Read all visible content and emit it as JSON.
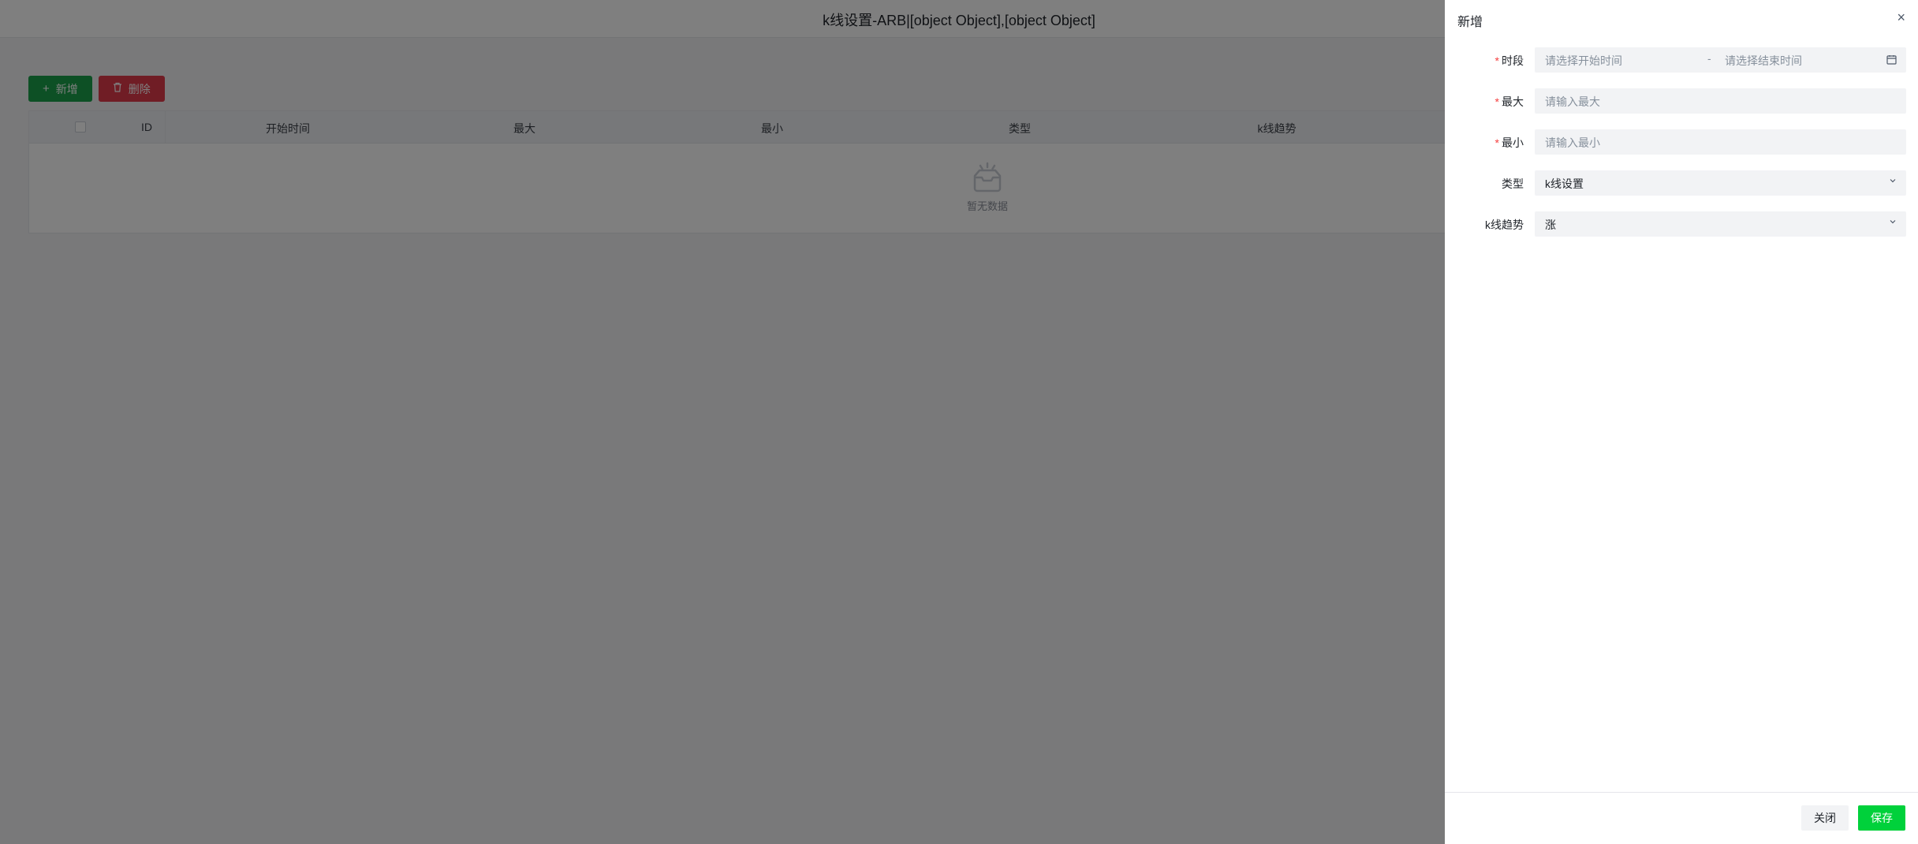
{
  "page": {
    "title": "k线设置-ARB|[object Object],[object Object]",
    "toolbar": {
      "add_label": "新增",
      "delete_label": "删除"
    },
    "table": {
      "columns": [
        "ID",
        "开始时间",
        "最大",
        "最小",
        "类型",
        "k线趋势"
      ],
      "empty_text": "暂无数据"
    }
  },
  "drawer": {
    "title": "新增",
    "close_glyph": "×",
    "fields": {
      "period": {
        "label": "时段",
        "required": true,
        "start_placeholder": "请选择开始时间",
        "separator": "-",
        "end_placeholder": "请选择结束时间"
      },
      "max": {
        "label": "最大",
        "required": true,
        "placeholder": "请输入最大"
      },
      "min": {
        "label": "最小",
        "required": true,
        "placeholder": "请输入最小"
      },
      "type": {
        "label": "类型",
        "required": false,
        "value": "k线设置"
      },
      "trend": {
        "label": "k线趋势",
        "required": false,
        "value": "涨"
      }
    },
    "footer": {
      "close_label": "关闭",
      "save_label": "保存"
    }
  },
  "colors": {
    "primary_green": "#00d13b",
    "add_green": "#1aa14a",
    "danger_red": "#e03b4b",
    "required_red": "#f53f3f"
  }
}
